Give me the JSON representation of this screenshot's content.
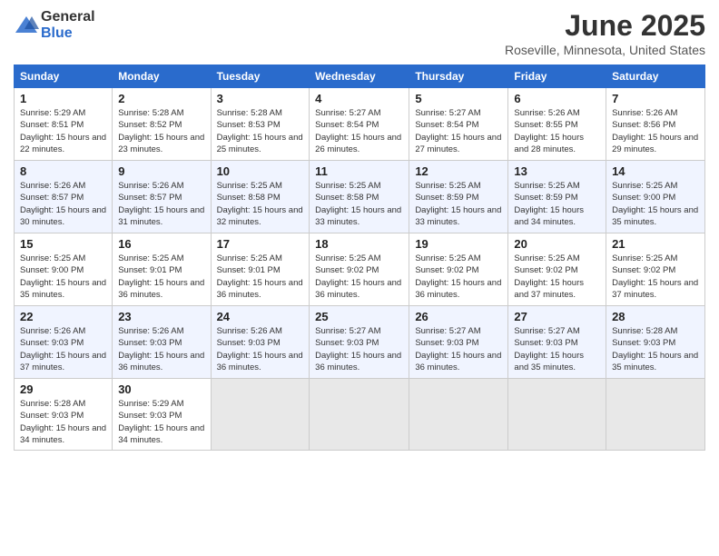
{
  "header": {
    "logo_general": "General",
    "logo_blue": "Blue",
    "title": "June 2025",
    "location": "Roseville, Minnesota, United States"
  },
  "weekdays": [
    "Sunday",
    "Monday",
    "Tuesday",
    "Wednesday",
    "Thursday",
    "Friday",
    "Saturday"
  ],
  "weeks": [
    [
      {
        "day": "1",
        "sunrise": "5:29 AM",
        "sunset": "8:51 PM",
        "daylight": "15 hours and 22 minutes."
      },
      {
        "day": "2",
        "sunrise": "5:28 AM",
        "sunset": "8:52 PM",
        "daylight": "15 hours and 23 minutes."
      },
      {
        "day": "3",
        "sunrise": "5:28 AM",
        "sunset": "8:53 PM",
        "daylight": "15 hours and 25 minutes."
      },
      {
        "day": "4",
        "sunrise": "5:27 AM",
        "sunset": "8:54 PM",
        "daylight": "15 hours and 26 minutes."
      },
      {
        "day": "5",
        "sunrise": "5:27 AM",
        "sunset": "8:54 PM",
        "daylight": "15 hours and 27 minutes."
      },
      {
        "day": "6",
        "sunrise": "5:26 AM",
        "sunset": "8:55 PM",
        "daylight": "15 hours and 28 minutes."
      },
      {
        "day": "7",
        "sunrise": "5:26 AM",
        "sunset": "8:56 PM",
        "daylight": "15 hours and 29 minutes."
      }
    ],
    [
      {
        "day": "8",
        "sunrise": "5:26 AM",
        "sunset": "8:57 PM",
        "daylight": "15 hours and 30 minutes."
      },
      {
        "day": "9",
        "sunrise": "5:26 AM",
        "sunset": "8:57 PM",
        "daylight": "15 hours and 31 minutes."
      },
      {
        "day": "10",
        "sunrise": "5:25 AM",
        "sunset": "8:58 PM",
        "daylight": "15 hours and 32 minutes."
      },
      {
        "day": "11",
        "sunrise": "5:25 AM",
        "sunset": "8:58 PM",
        "daylight": "15 hours and 33 minutes."
      },
      {
        "day": "12",
        "sunrise": "5:25 AM",
        "sunset": "8:59 PM",
        "daylight": "15 hours and 33 minutes."
      },
      {
        "day": "13",
        "sunrise": "5:25 AM",
        "sunset": "8:59 PM",
        "daylight": "15 hours and 34 minutes."
      },
      {
        "day": "14",
        "sunrise": "5:25 AM",
        "sunset": "9:00 PM",
        "daylight": "15 hours and 35 minutes."
      }
    ],
    [
      {
        "day": "15",
        "sunrise": "5:25 AM",
        "sunset": "9:00 PM",
        "daylight": "15 hours and 35 minutes."
      },
      {
        "day": "16",
        "sunrise": "5:25 AM",
        "sunset": "9:01 PM",
        "daylight": "15 hours and 36 minutes."
      },
      {
        "day": "17",
        "sunrise": "5:25 AM",
        "sunset": "9:01 PM",
        "daylight": "15 hours and 36 minutes."
      },
      {
        "day": "18",
        "sunrise": "5:25 AM",
        "sunset": "9:02 PM",
        "daylight": "15 hours and 36 minutes."
      },
      {
        "day": "19",
        "sunrise": "5:25 AM",
        "sunset": "9:02 PM",
        "daylight": "15 hours and 36 minutes."
      },
      {
        "day": "20",
        "sunrise": "5:25 AM",
        "sunset": "9:02 PM",
        "daylight": "15 hours and 37 minutes."
      },
      {
        "day": "21",
        "sunrise": "5:25 AM",
        "sunset": "9:02 PM",
        "daylight": "15 hours and 37 minutes."
      }
    ],
    [
      {
        "day": "22",
        "sunrise": "5:26 AM",
        "sunset": "9:03 PM",
        "daylight": "15 hours and 37 minutes."
      },
      {
        "day": "23",
        "sunrise": "5:26 AM",
        "sunset": "9:03 PM",
        "daylight": "15 hours and 36 minutes."
      },
      {
        "day": "24",
        "sunrise": "5:26 AM",
        "sunset": "9:03 PM",
        "daylight": "15 hours and 36 minutes."
      },
      {
        "day": "25",
        "sunrise": "5:27 AM",
        "sunset": "9:03 PM",
        "daylight": "15 hours and 36 minutes."
      },
      {
        "day": "26",
        "sunrise": "5:27 AM",
        "sunset": "9:03 PM",
        "daylight": "15 hours and 36 minutes."
      },
      {
        "day": "27",
        "sunrise": "5:27 AM",
        "sunset": "9:03 PM",
        "daylight": "15 hours and 35 minutes."
      },
      {
        "day": "28",
        "sunrise": "5:28 AM",
        "sunset": "9:03 PM",
        "daylight": "15 hours and 35 minutes."
      }
    ],
    [
      {
        "day": "29",
        "sunrise": "5:28 AM",
        "sunset": "9:03 PM",
        "daylight": "15 hours and 34 minutes."
      },
      {
        "day": "30",
        "sunrise": "5:29 AM",
        "sunset": "9:03 PM",
        "daylight": "15 hours and 34 minutes."
      },
      null,
      null,
      null,
      null,
      null
    ]
  ]
}
